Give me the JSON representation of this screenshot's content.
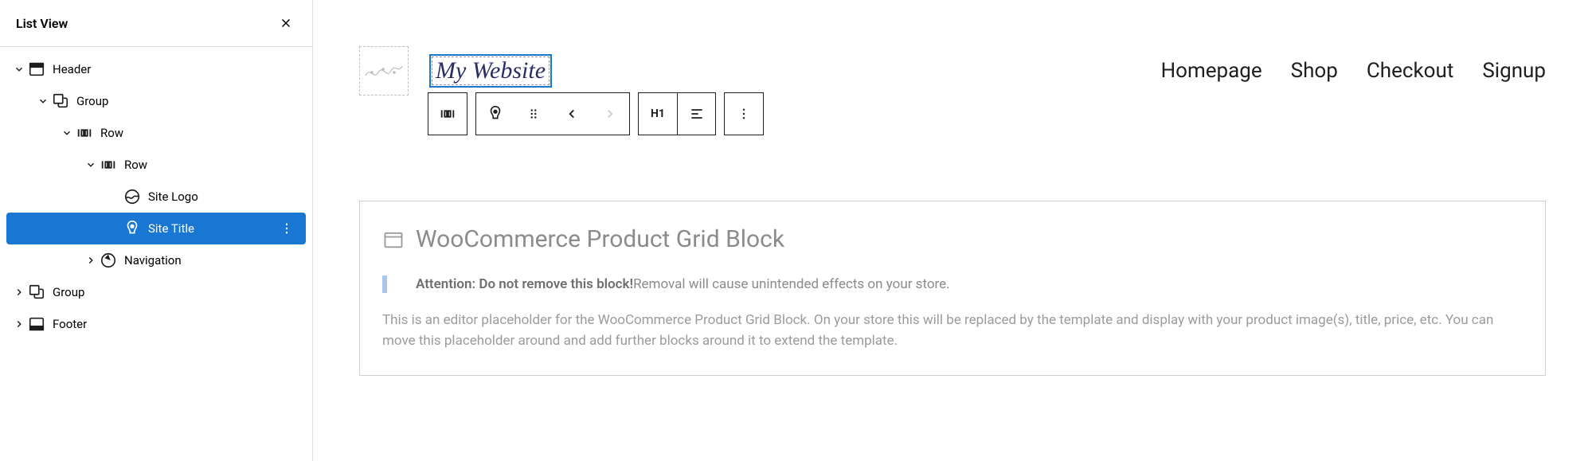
{
  "sidebar": {
    "title": "List View",
    "items": [
      {
        "label": "Header"
      },
      {
        "label": "Group"
      },
      {
        "label": "Row"
      },
      {
        "label": "Row"
      },
      {
        "label": "Site Logo"
      },
      {
        "label": "Site Title"
      },
      {
        "label": "Navigation"
      },
      {
        "label": "Group"
      },
      {
        "label": "Footer"
      }
    ]
  },
  "header": {
    "site_title": "My Website",
    "nav": [
      "Homepage",
      "Shop",
      "Checkout",
      "Signup"
    ]
  },
  "toolbar": {
    "heading": "H1"
  },
  "placeholder": {
    "title": "WooCommerce Product Grid Block",
    "attention_strong": "Attention: Do not remove this block!",
    "attention_rest": " Removal will cause unintended effects on your store.",
    "description": "This is an editor placeholder for the WooCommerce Product Grid Block. On your store this will be replaced by the template and display with your product image(s), title, price, etc. You can move this placeholder around and add further blocks around it to extend the template."
  }
}
